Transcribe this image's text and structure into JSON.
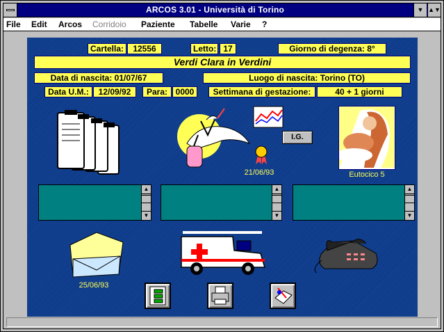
{
  "window": {
    "title": "ARCOS 3.01 - Università di Torino"
  },
  "menu": {
    "items": [
      {
        "label": "File",
        "enabled": true
      },
      {
        "label": "Edit",
        "enabled": true
      },
      {
        "label": "Arcos",
        "enabled": true
      },
      {
        "label": "Corridoio",
        "enabled": false
      },
      {
        "label": "Paziente",
        "enabled": true
      },
      {
        "label": "Tabelle",
        "enabled": true
      },
      {
        "label": "Varie",
        "enabled": true
      },
      {
        "label": "?",
        "enabled": true
      }
    ]
  },
  "record": {
    "cartella_label": "Cartella:",
    "cartella_value": "12556",
    "letto_label": "Letto:",
    "letto_value": "17",
    "degenza": "Giorno di degenza: 8°",
    "patient_name": "Verdi Clara in Verdini",
    "nascita": "Data di nascita: 01/07/67",
    "luogo": "Luogo di nascita: Torino (TO)",
    "um_label": "Data U.M.:",
    "um_value": "12/09/92",
    "para_label": "Para:",
    "para_value": "0000",
    "gestazione_label": "Settimana di gestazione:",
    "gestazione_value": "40 + 1 giorni"
  },
  "icons": {
    "stork_date": "21/06/93",
    "birth_caption": "Eutocico 5",
    "letter_date": "25/06/93",
    "ig_label": "I.G."
  },
  "colors": {
    "background": "#0c3a8a",
    "field": "#ffff55",
    "listbox": "#008080",
    "titlebar": "#000080"
  }
}
